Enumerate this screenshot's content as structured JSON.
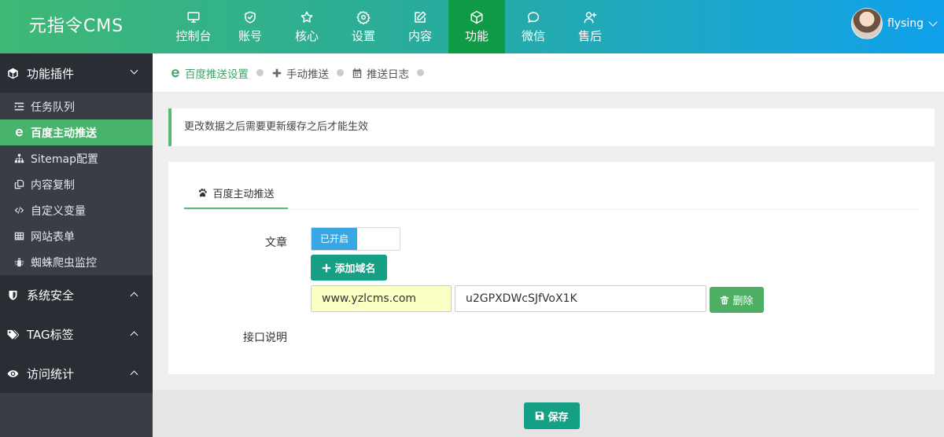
{
  "app": {
    "logo": "元指令CMS"
  },
  "nav": [
    {
      "label": "控制台",
      "icon": "monitor-icon"
    },
    {
      "label": "账号",
      "icon": "shield-check-icon"
    },
    {
      "label": "核心",
      "icon": "star-icon"
    },
    {
      "label": "设置",
      "icon": "gear-icon"
    },
    {
      "label": "内容",
      "icon": "edit-icon"
    },
    {
      "label": "功能",
      "icon": "cube-icon",
      "active": true
    },
    {
      "label": "微信",
      "icon": "chat-icon"
    },
    {
      "label": "售后",
      "icon": "user-plus-icon"
    }
  ],
  "user": {
    "name": "flysing"
  },
  "sidebar": {
    "groups": [
      {
        "label": "功能插件",
        "icon": "cube-icon",
        "expanded": true,
        "items": [
          {
            "label": "任务队列",
            "icon": "list-indent-icon"
          },
          {
            "label": "百度主动推送",
            "icon": "ie-icon",
            "active": true
          },
          {
            "label": "Sitemap配置",
            "icon": "sitemap-icon"
          },
          {
            "label": "内容复制",
            "icon": "copy-icon"
          },
          {
            "label": "自定义变量",
            "icon": "code-icon"
          },
          {
            "label": "网站表单",
            "icon": "table-icon"
          },
          {
            "label": "蜘蛛爬虫监控",
            "icon": "bug-icon"
          }
        ]
      },
      {
        "label": "系统安全",
        "icon": "shield-icon",
        "expanded": false
      },
      {
        "label": "TAG标签",
        "icon": "tags-icon",
        "expanded": false
      },
      {
        "label": "访问统计",
        "icon": "eye-icon",
        "expanded": false
      }
    ]
  },
  "crumbs": [
    {
      "label": "百度推送设置",
      "icon": "ie-icon",
      "active": true
    },
    {
      "label": "手动推送",
      "icon": "plus-icon"
    },
    {
      "label": "推送日志",
      "icon": "calendar-icon"
    }
  ],
  "notice": "更改数据之后需要更新缓存之后才能生效",
  "panel": {
    "tab": {
      "label": "百度主动推送",
      "icon": "paw-icon"
    },
    "article_label": "文章",
    "toggle_on": "已开启",
    "add_domain": "添加域名",
    "domain_value": "www.yzlcms.com",
    "token_value": "u2GPXDWcSJfVoX1K",
    "delete": "删除",
    "api_label": "接口说明"
  },
  "footer": {
    "save": "保存"
  },
  "colors": {
    "accent": "#5ab978",
    "active_nav": "#0f9a46",
    "primary_btn": "#15a085",
    "toggle_on": "#39a7e6"
  }
}
